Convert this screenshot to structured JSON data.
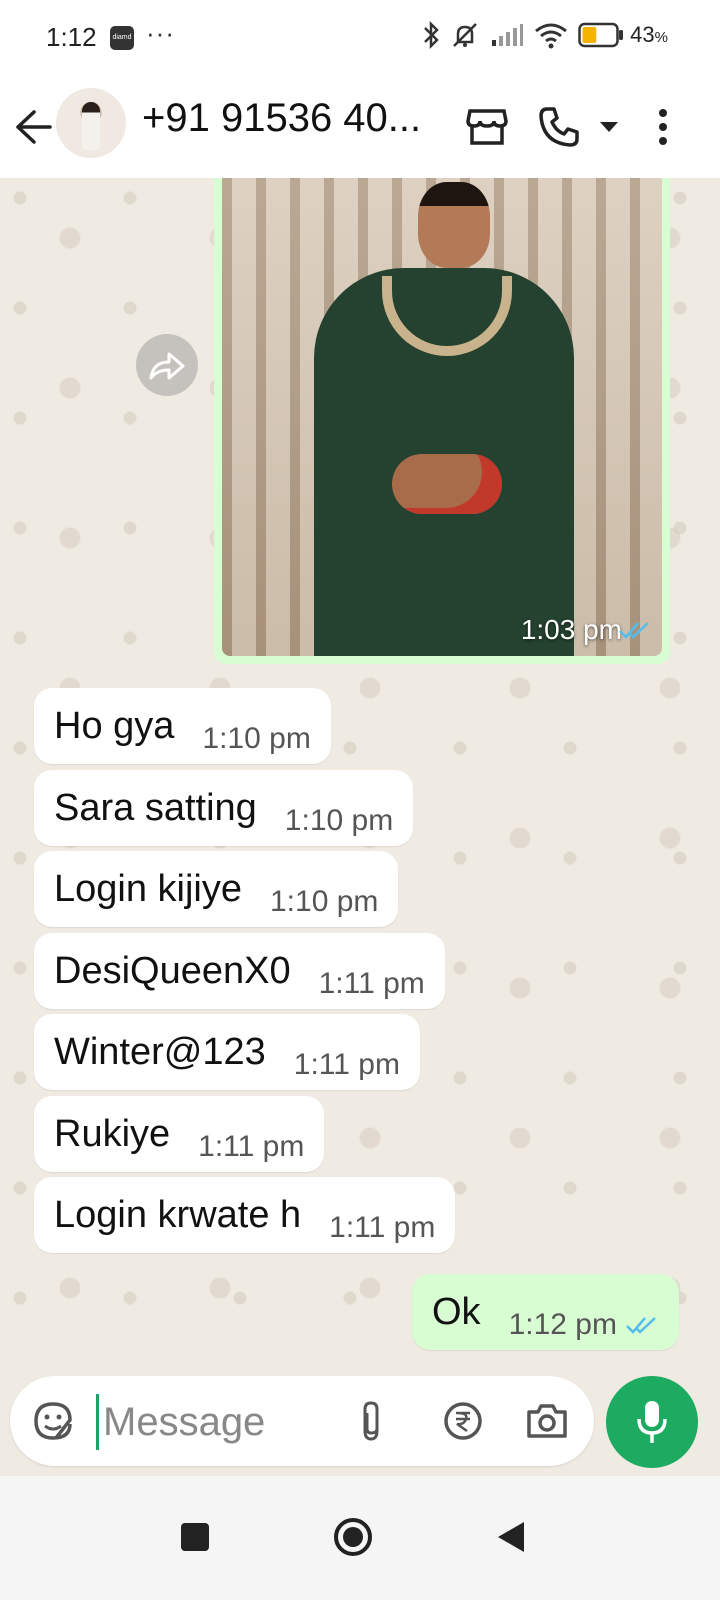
{
  "status_bar": {
    "time": "1:12",
    "app_icon_label": "diamd",
    "more": "···",
    "battery_percent": "43",
    "battery_unit": "%",
    "battery_level": 0.43,
    "icons": [
      "bluetooth-icon",
      "silent-bell-icon",
      "signal-icon",
      "wifi-icon",
      "battery-icon"
    ]
  },
  "header": {
    "contact_name": "+91 91536 40...",
    "icons": [
      "back-arrow-icon",
      "store-icon",
      "phone-icon",
      "dropdown-icon",
      "more-vertical-icon"
    ]
  },
  "chat": {
    "image_message": {
      "time": "1:03 pm",
      "status": "read"
    },
    "incoming": [
      {
        "text": "Ho gya",
        "time": "1:10 pm"
      },
      {
        "text": "Sara satting",
        "time": "1:10 pm"
      },
      {
        "text": "Login kijiye",
        "time": "1:10 pm"
      },
      {
        "text": "DesiQueenX0",
        "time": "1:11 pm"
      },
      {
        "text": "Winter@123",
        "time": "1:11 pm"
      },
      {
        "text": "Rukiye",
        "time": "1:11 pm"
      },
      {
        "text": "Login krwate h",
        "time": "1:11 pm"
      }
    ],
    "outgoing": [
      {
        "text": "Ok",
        "time": "1:12 pm",
        "status": "read"
      }
    ]
  },
  "composer": {
    "placeholder": "Message",
    "value": "",
    "icons": [
      "sticker-icon",
      "attach-icon",
      "rupee-payment-icon",
      "camera-icon",
      "microphone-icon"
    ]
  },
  "colors": {
    "accent": "#1daa61",
    "outgoing_bubble": "#d9fdd3",
    "read_tick": "#53bdeb",
    "chat_bg": "#efeae2"
  }
}
